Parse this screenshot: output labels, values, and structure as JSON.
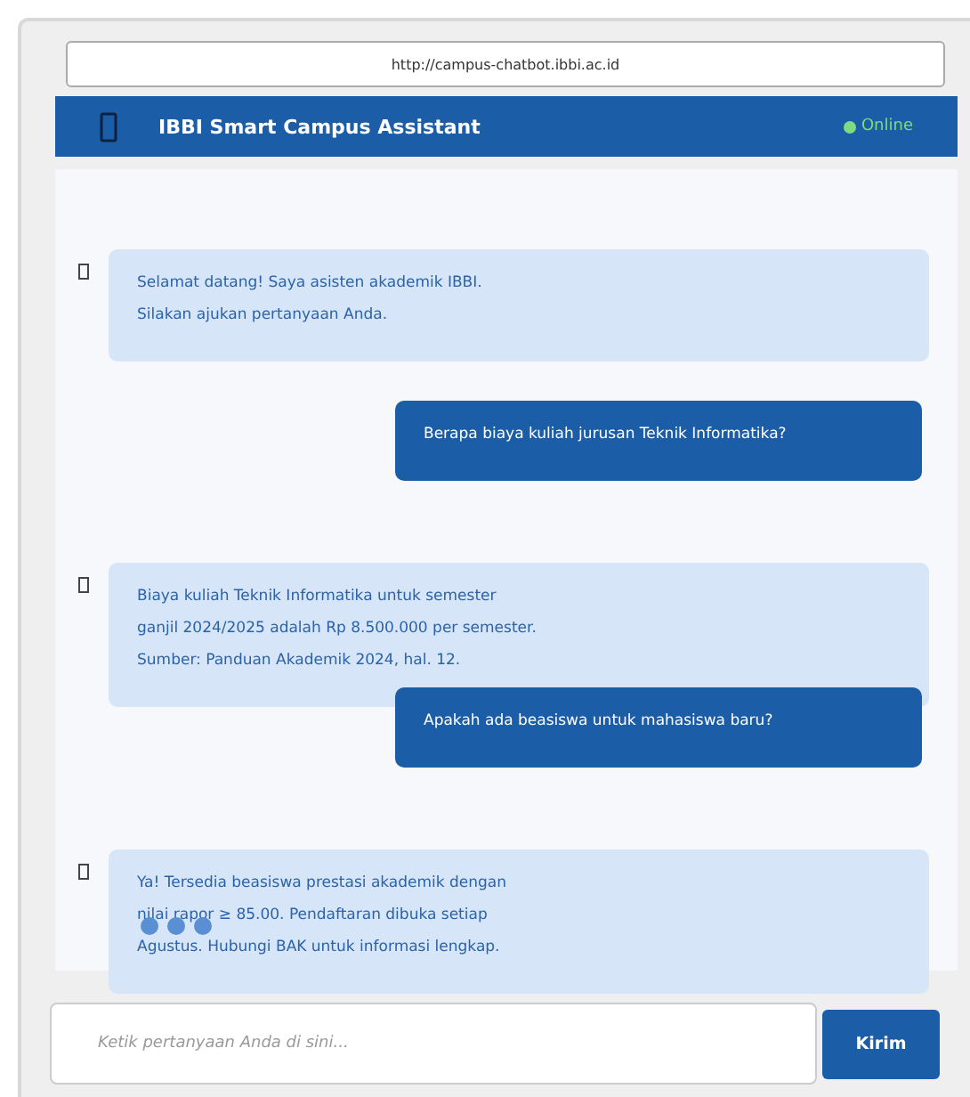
{
  "browser": {
    "url": "http://campus-chatbot.ibbi.ac.id"
  },
  "header": {
    "title": "IBBI Smart Campus Assistant",
    "status": "Online",
    "online": true
  },
  "messages": [
    {
      "kind": "bot",
      "lines": [
        "Selamat datang! Saya asisten akademik IBBI.",
        "Silakan ajukan pertanyaan Anda."
      ]
    },
    {
      "kind": "user",
      "lines": [
        "Berapa biaya kuliah jurusan Teknik Informatika?"
      ]
    },
    {
      "kind": "bot",
      "lines": [
        "Biaya kuliah Teknik Informatika untuk semester",
        "ganjil 2024/2025 adalah Rp 8.500.000 per semester.",
        "Sumber: Panduan Akademik 2024, hal. 12."
      ]
    },
    {
      "kind": "user",
      "lines": [
        "Apakah ada beasiswa untuk mahasiswa baru?"
      ]
    },
    {
      "kind": "bot",
      "typing": true,
      "lines": [
        "Ya! Tersedia beasiswa prestasi akademik dengan",
        "nilai rapor ≥ 85.00. Pendaftaran dibuka setiap",
        "Agustus. Hubungi BAK untuk informasi lengkap."
      ]
    }
  ],
  "composer": {
    "placeholder": "Ketik pertanyaan Anda di sini...",
    "send_label": "Kirim"
  }
}
